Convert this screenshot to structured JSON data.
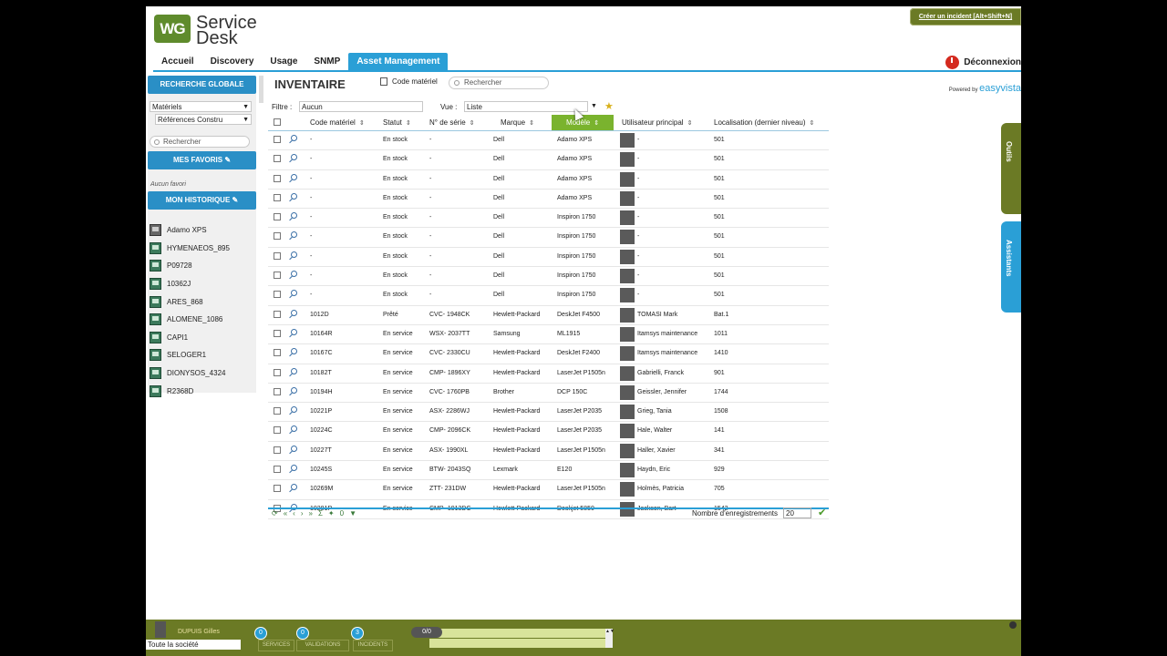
{
  "header": {
    "logo_mark": "WG",
    "logo_line1": "Service",
    "logo_line2": "Desk",
    "create_incident": "Créer un incident [Alt+Shift+N]",
    "logout": "Déconnexion"
  },
  "nav": [
    "Accueil",
    "Discovery",
    "Usage",
    "SNMP",
    "Asset Management"
  ],
  "sidebar": {
    "search_button": "RECHERCHE GLOBALE",
    "category": "Matériels",
    "subcategory": "Références Constru",
    "search_placeholder": "Rechercher",
    "favorites_button": "MES FAVORIS",
    "no_favorites": "Aucun favori",
    "history_button": "MON HISTORIQUE",
    "history": [
      "Adamo XPS",
      "HYMENAEOS_895",
      "P09728",
      "10362J",
      "ARES_868",
      "ALOMENE_1086",
      "CAPI1",
      "SELOGER1",
      "DIONYSOS_4324",
      "R2368D"
    ]
  },
  "content": {
    "title": "INVENTAIRE",
    "code_materiel": "Code matériel",
    "search_placeholder": "Rechercher",
    "powered_by": "Powered by",
    "brand_a": "easy",
    "brand_b": "vista",
    "filter_label": "Filtre :",
    "filter_value": "Aucun",
    "vue_label": "Vue :",
    "vue_value": "Liste"
  },
  "table": {
    "columns": [
      "Code matériel",
      "Statut",
      "N° de série",
      "Marque",
      "Modèle",
      "Utilisateur principal",
      "Localisation (dernier niveau)"
    ],
    "rows": [
      [
        "-",
        "En stock",
        "-",
        "Dell",
        "Adamo XPS",
        "-",
        "501"
      ],
      [
        "-",
        "En stock",
        "-",
        "Dell",
        "Adamo XPS",
        "-",
        "501"
      ],
      [
        "-",
        "En stock",
        "-",
        "Dell",
        "Adamo XPS",
        "-",
        "501"
      ],
      [
        "-",
        "En stock",
        "-",
        "Dell",
        "Adamo XPS",
        "-",
        "501"
      ],
      [
        "-",
        "En stock",
        "-",
        "Dell",
        "Inspiron 1750",
        "-",
        "501"
      ],
      [
        "-",
        "En stock",
        "-",
        "Dell",
        "Inspiron 1750",
        "-",
        "501"
      ],
      [
        "-",
        "En stock",
        "-",
        "Dell",
        "Inspiron 1750",
        "-",
        "501"
      ],
      [
        "-",
        "En stock",
        "-",
        "Dell",
        "Inspiron 1750",
        "-",
        "501"
      ],
      [
        "-",
        "En stock",
        "-",
        "Dell",
        "Inspiron 1750",
        "-",
        "501"
      ],
      [
        "1012D",
        "Prêté",
        "CVC- 1948CK",
        "Hewlett-Packard",
        "DeskJet F4500",
        "TOMASI Mark",
        "Bat.1"
      ],
      [
        "10164R",
        "En service",
        "WSX- 2037TT",
        "Samsung",
        "ML1915",
        "Itamsys maintenance",
        "1011"
      ],
      [
        "10167C",
        "En service",
        "CVC- 2330CU",
        "Hewlett-Packard",
        "DeskJet F2400",
        "Itamsys maintenance",
        "1410"
      ],
      [
        "10182T",
        "En service",
        "CMP- 1896XY",
        "Hewlett-Packard",
        "LaserJet P1505n",
        "Gabrielli, Franck",
        "901"
      ],
      [
        "10194H",
        "En service",
        "CVC- 1760PB",
        "Brother",
        "DCP 150C",
        "Geissler, Jennifer",
        "1744"
      ],
      [
        "10221P",
        "En service",
        "ASX- 2286WJ",
        "Hewlett-Packard",
        "LaserJet P2035",
        "Grieg, Tania",
        "1508"
      ],
      [
        "10224C",
        "En service",
        "CMP- 2096CK",
        "Hewlett-Packard",
        "LaserJet P2035",
        "Hale, Walter",
        "141"
      ],
      [
        "10227T",
        "En service",
        "ASX- 1990XL",
        "Hewlett-Packard",
        "LaserJet P1505n",
        "Haller, Xavier",
        "341"
      ],
      [
        "10245S",
        "En service",
        "BTW- 2043SQ",
        "Lexmark",
        "E120",
        "Haydn, Eric",
        "929"
      ],
      [
        "10269M",
        "En service",
        "ZTT- 231DW",
        "Hewlett-Packard",
        "LaserJet P1505n",
        "Holmès, Patricia",
        "705"
      ],
      [
        "10281P",
        "En service",
        "CMP- 1913DC",
        "Hewlett-Packard",
        "Deskjet 5850",
        "Jackson, Bart",
        "1542"
      ]
    ],
    "pager_count": "0",
    "records_label": "Nombre d'enregistrements",
    "records_value": "20"
  },
  "side_tabs": {
    "tools": "Outils",
    "assistants": "Assistants"
  },
  "bottom": {
    "user": "DUPUIS Gilles",
    "company": "Toute la société",
    "badges": [
      {
        "count": "0",
        "label": "SERVICES"
      },
      {
        "count": "0",
        "label": "VALIDATIONS"
      },
      {
        "count": "3",
        "label": "INCIDENTS"
      }
    ],
    "progress": "0/0"
  },
  "colors": {
    "accent_blue": "#2a9fd6",
    "olive": "#6b7a25",
    "green_header": "#7ab32e"
  }
}
